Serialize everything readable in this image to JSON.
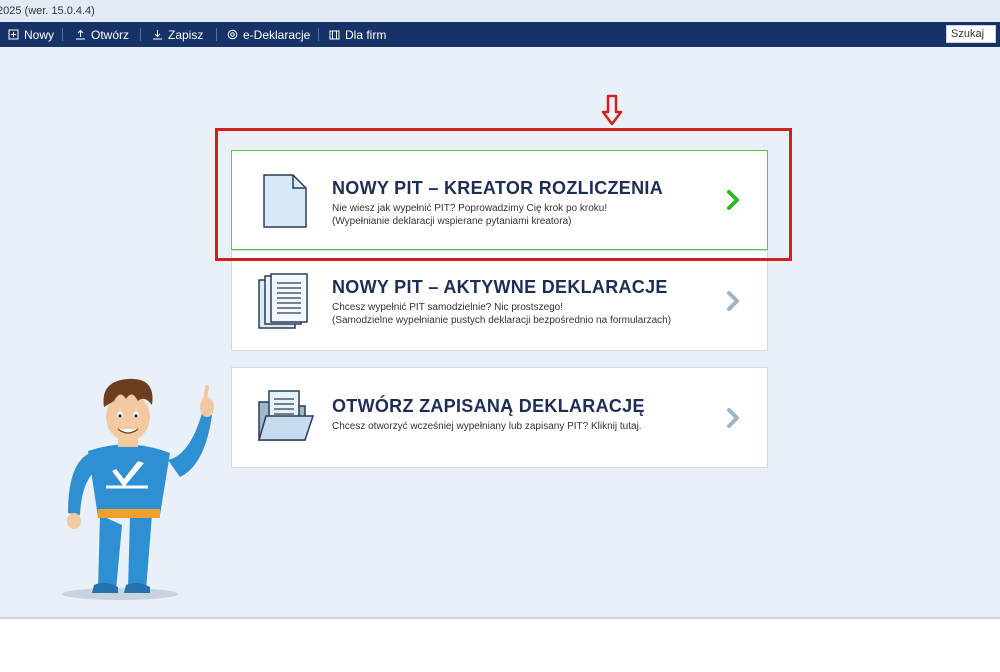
{
  "titlebar": {
    "text": "2025 (wer. 15.0.4.4)"
  },
  "toolbar": {
    "new_label": "Nowy",
    "open_label": "Otwórz",
    "save_label": "Zapisz",
    "edeclaration_label": "e-Deklaracje",
    "business_label": "Dla firm",
    "search_placeholder": "Szukaj"
  },
  "cards": [
    {
      "title": "NOWY PIT – KREATOR ROZLICZENIA",
      "desc_line1": "Nie wiesz jak wypełnić PIT? Poprowadzimy Cię krok po kroku!",
      "desc_line2": "(Wypełnianie deklaracji wspierane pytaniami kreatora)",
      "icon": "blank-document-icon",
      "arrow_color": "#2fb52a"
    },
    {
      "title": "NOWY PIT – AKTYWNE DEKLARACJE",
      "desc_line1": "Chcesz wypełnić PIT samodzielnie? Nic prostszego!",
      "desc_line2": "(Samodzielne wypełnianie pustych deklaracji bezpośrednio na formularzach)",
      "icon": "stacked-documents-icon",
      "arrow_color": "#9fb4c6"
    },
    {
      "title": "OTWÓRZ ZAPISANĄ DEKLARACJĘ",
      "desc_line1": "Chcesz otworzyć wcześniej wypełniany lub zapisany PIT? Kliknij tutaj.",
      "desc_line2": "",
      "icon": "open-folder-icon",
      "arrow_color": "#9fb4c6"
    }
  ],
  "colors": {
    "toolbar_bg": "#173267",
    "title_text": "#1d2d55",
    "highlight_red": "#d31f1f",
    "active_green": "#55c84b"
  }
}
